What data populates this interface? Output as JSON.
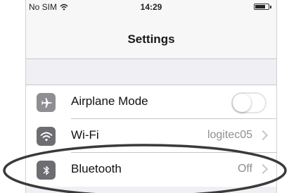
{
  "status_bar": {
    "carrier": "No SIM",
    "time": "14:29",
    "battery_level": 0.7
  },
  "nav": {
    "title": "Settings"
  },
  "settings": {
    "items": [
      {
        "label": "Airplane Mode",
        "icon": "airplane-icon",
        "control": "toggle",
        "toggle_on": false
      },
      {
        "label": "Wi-Fi",
        "icon": "wifi-icon",
        "value": "logitec05",
        "control": "chevron"
      },
      {
        "label": "Bluetooth",
        "icon": "bluetooth-icon",
        "value": "Off",
        "control": "chevron"
      }
    ]
  },
  "colors": {
    "background": "#efeff4",
    "icon_gray": "#8e8e93",
    "value_gray": "#8e8e93",
    "separator": "#c8c7cc",
    "annotation_ellipse": "#3a3a3a"
  }
}
